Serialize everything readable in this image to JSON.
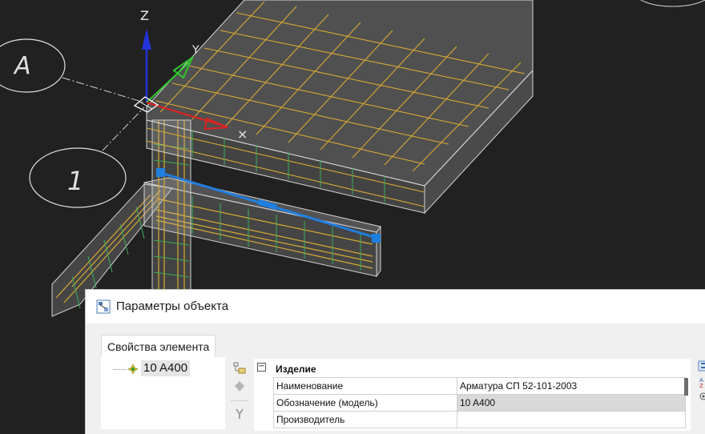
{
  "viewport": {
    "axis_z_label": "Z",
    "axis_y_label": "Y",
    "grid_label_a": "А",
    "grid_label_1": "1"
  },
  "dialog": {
    "title": "Параметры объекта",
    "tab_label": "Свойства элемента",
    "tree": {
      "node_label": "10 A400"
    },
    "properties": {
      "group_label": "Изделие",
      "collapse_symbol": "⊟",
      "rows": [
        {
          "name": "Наименование",
          "value": "Арматура СП 52-101-2003"
        },
        {
          "name": "Обозначение (модель)",
          "value": "10 A400"
        },
        {
          "name": "Производитель",
          "value": ""
        }
      ]
    }
  },
  "colors": {
    "background": "#212121",
    "slab_edge": "#cfcfcf",
    "rebar_main": "#d8a934",
    "rebar_stirrup": "#3cae5a",
    "selection": "#1f7fe0",
    "axis_x": "#e02020",
    "axis_y": "#2ec82e",
    "axis_z": "#2433d8"
  },
  "icons": [
    "object-params-icon",
    "rebar-node-icon",
    "tree-tool-icon",
    "tag-icon",
    "cut-icon",
    "sort-category-icon",
    "sort-az-icon",
    "filter-icon"
  ]
}
